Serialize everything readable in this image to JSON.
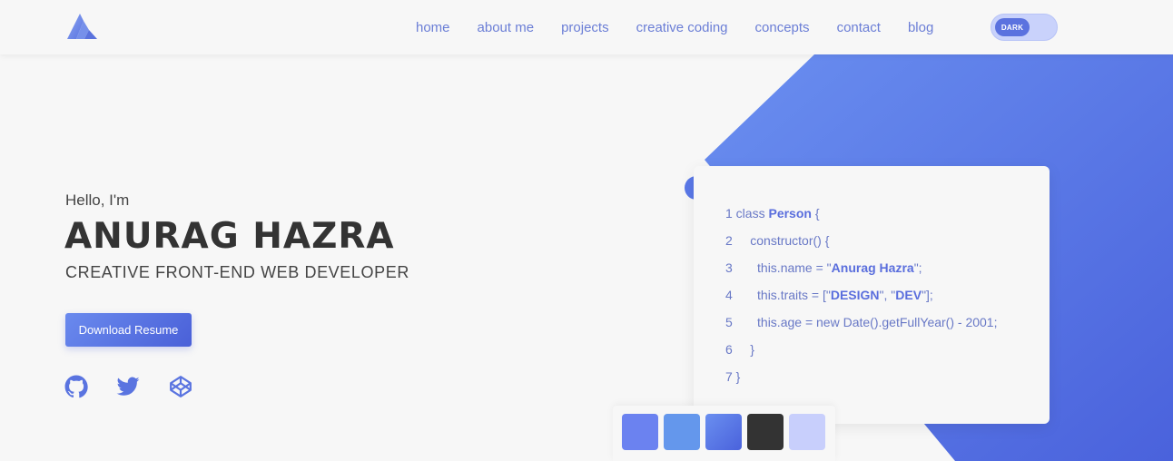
{
  "nav": {
    "logo_name": "logo-mark",
    "links": [
      "home",
      "about me",
      "projects",
      "creative coding",
      "concepts",
      "contact",
      "blog"
    ],
    "theme_toggle_label": "DARK"
  },
  "hero": {
    "greeting": "Hello, I'm",
    "name": "ANURAG HAZRA",
    "role": "CREATIVE FRONT-END WEB DEVELOPER",
    "download_label": "Download Resume",
    "social_icons": [
      "github-icon",
      "twitter-icon",
      "codepen-icon"
    ]
  },
  "code": {
    "lines": [
      {
        "n": "1",
        "pre": " class ",
        "kw": "Person",
        "post": " {"
      },
      {
        "n": "2",
        "pre": "     constructor() {",
        "kw": "",
        "post": ""
      },
      {
        "n": "3",
        "pre": "       this.name = \"",
        "kw": "Anurag Hazra",
        "post": "\";"
      },
      {
        "n": "4",
        "pre": "       this.traits = [\"",
        "kw": "DESIGN",
        "post": "\", \"DEV\"];"
      },
      {
        "n": "5",
        "pre": "       this.age = new Date().getFullYear() - 2001;",
        "kw": "",
        "post": ""
      },
      {
        "n": "6",
        "pre": "     }",
        "kw": "",
        "post": ""
      },
      {
        "n": "7",
        "pre": " }",
        "kw": "",
        "post": ""
      }
    ]
  },
  "colors": {
    "accent": "#5a78e8",
    "swatches": [
      "#6b82f0",
      "#6497ec",
      "#5673e2",
      "#333333",
      "#c8cffc"
    ]
  }
}
